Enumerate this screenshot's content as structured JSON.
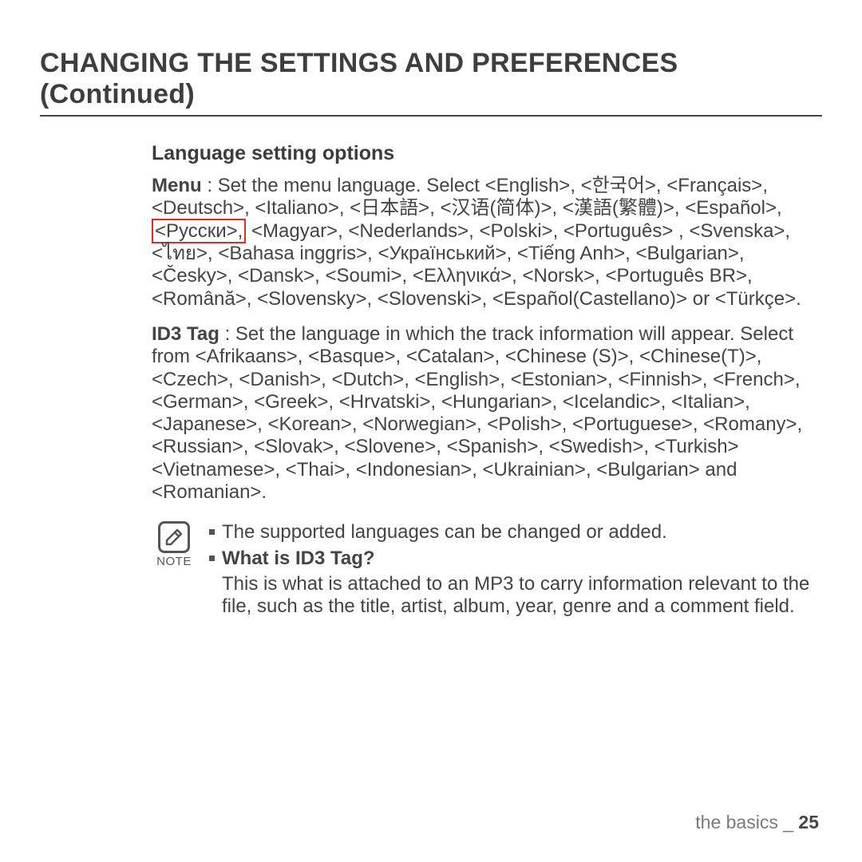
{
  "title": "CHANGING THE SETTINGS AND PREFERENCES (Continued)",
  "subtitle": "Language setting options",
  "menu": {
    "label": "Menu",
    "intro": " : Set the menu language. Select <English>, <한국어>, <Français>, <Deutsch>, <Italiano>, <日本語>, <汉语(简体)>, <漢語(繁體)>, <Español>, ",
    "highlighted": "<Русски>,",
    "rest": " <Magyar>, <Nederlands>, <Polski>, <Português> , <Svenska>, <ไทย>, <Bahasa inggris>, <Український>, <Tiếng Anh>, <Bulgarian>, <Česky>, <Dansk>, <Soumi>, <Ελληνικά>, <Norsk>, <Português BR>, <Română>, <Slovensky>, <Slovenski>, <Español(Castellano)> or <Türkçe>."
  },
  "id3": {
    "label": "ID3 Tag",
    "text": " : Set the language in which the track information will appear. Select from <Afrikaans>, <Basque>, <Catalan>, <Chinese (S)>, <Chinese(T)>, <Czech>, <Danish>, <Dutch>, <English>, <Estonian>, <Finnish>, <French>, <German>, <Greek>, <Hrvatski>, <Hungarian>, <Icelandic>, <Italian>, <Japanese>, <Korean>, <Norwegian>, <Polish>, <Portuguese>, <Romany>, <Russian>, <Slovak>, <Slovene>, <Spanish>, <Swedish>, <Turkish> <Vietnamese>, <Thai>, <Indonesian>, <Ukrainian>, <Bulgarian> and <Romanian>."
  },
  "note": {
    "label": "NOTE",
    "bullet1": "The supported languages can be changed or added.",
    "bullet2": "What is ID3 Tag?",
    "sub": "This is what is attached to an MP3 to carry information relevant to the file, such as the title, artist, album, year, genre and a comment field."
  },
  "footer": {
    "section": "the basics _ ",
    "page": "25"
  }
}
